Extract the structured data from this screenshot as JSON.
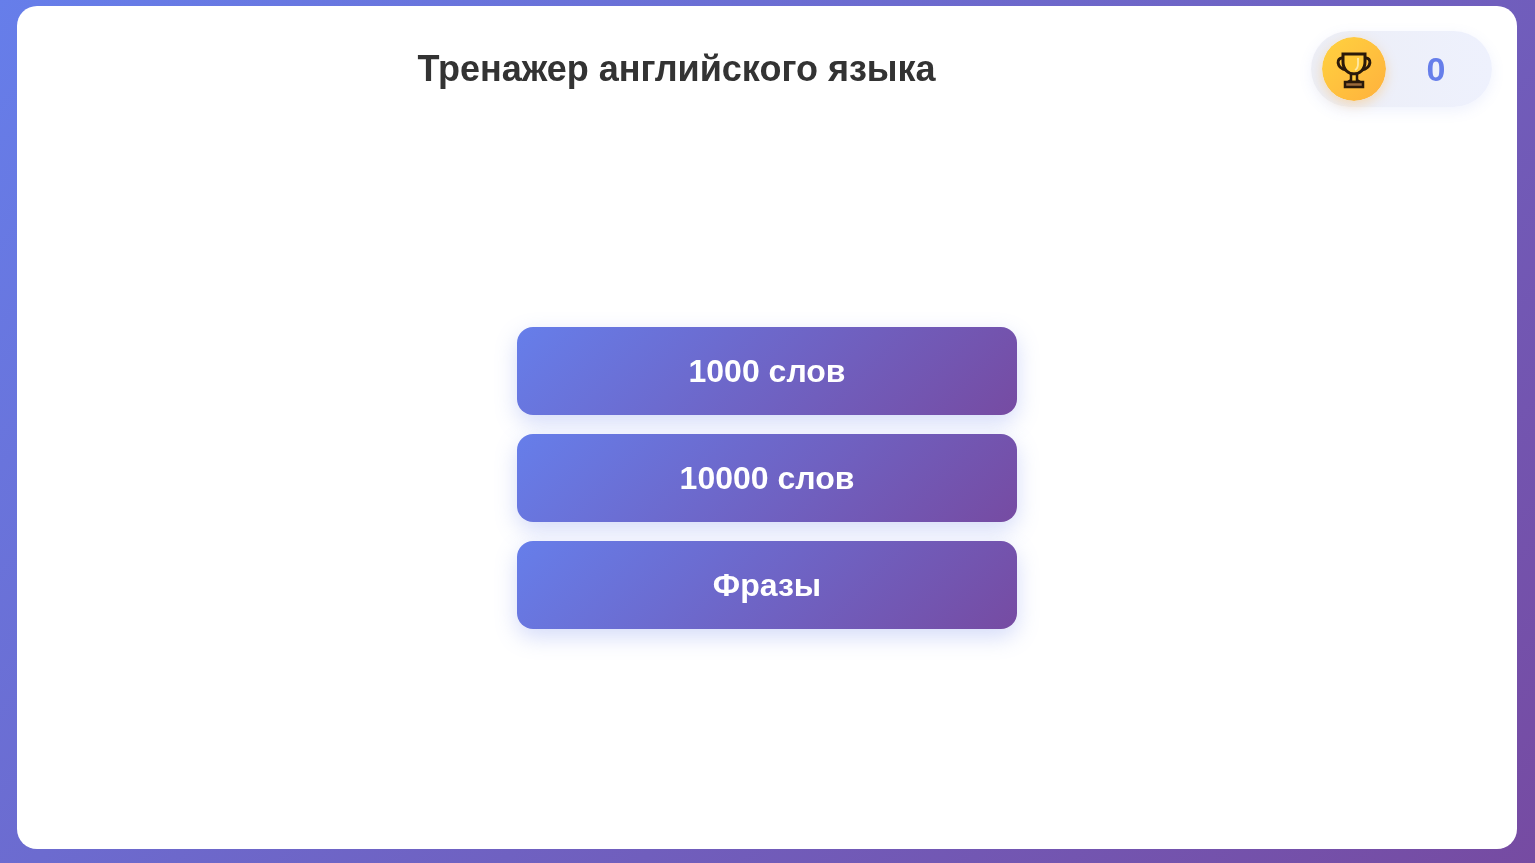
{
  "header": {
    "title": "Тренажер английского языка",
    "score": "0"
  },
  "modes": [
    {
      "label": "1000 слов"
    },
    {
      "label": "10000 слов"
    },
    {
      "label": "Фразы"
    }
  ]
}
